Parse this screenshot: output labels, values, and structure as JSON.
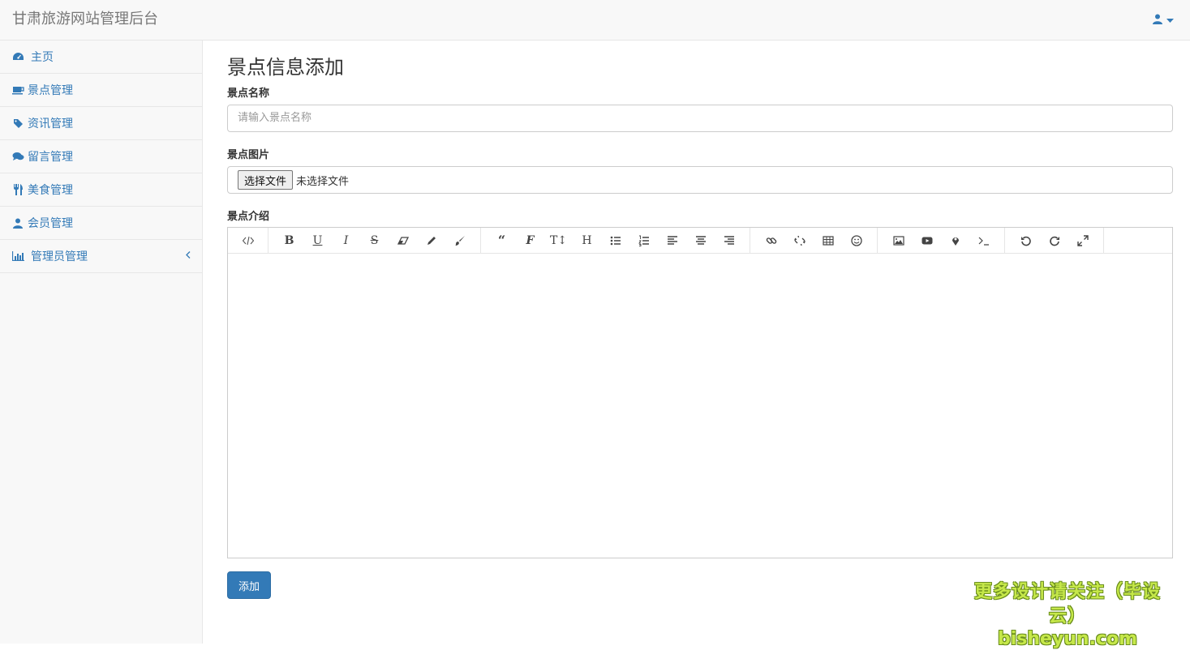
{
  "navbar": {
    "brand": "甘肃旅游网站管理后台",
    "user_icon": "user-icon"
  },
  "sidebar": {
    "items": [
      {
        "label": "主页",
        "icon": "dashboard-icon"
      },
      {
        "label": "景点管理",
        "icon": "coffee-icon"
      },
      {
        "label": "资讯管理",
        "icon": "tag-icon"
      },
      {
        "label": "留言管理",
        "icon": "comments-icon"
      },
      {
        "label": "美食管理",
        "icon": "cutlery-icon"
      },
      {
        "label": "会员管理",
        "icon": "user-icon"
      },
      {
        "label": "管理员管理",
        "icon": "bar-chart-icon"
      }
    ]
  },
  "main": {
    "title": "景点信息添加",
    "name_label": "景点名称",
    "name_placeholder": "请输入景点名称",
    "image_label": "景点图片",
    "file_button": "选择文件",
    "file_status": "未选择文件",
    "intro_label": "景点介绍",
    "submit_label": "添加"
  },
  "editor": {
    "toolbar_groups": [
      [
        "code-view-icon"
      ],
      [
        "bold-icon",
        "underline-icon",
        "italic-icon",
        "strikethrough-icon",
        "eraser-icon",
        "pencil-icon",
        "brush-icon"
      ],
      [
        "quote-icon",
        "font-icon",
        "font-size-icon",
        "heading-icon",
        "bullet-list-icon",
        "ordered-list-icon",
        "align-left-icon",
        "align-center-icon",
        "align-right-icon"
      ],
      [
        "link-icon",
        "unlink-icon",
        "table-icon",
        "emoji-icon"
      ],
      [
        "image-icon",
        "video-icon",
        "map-marker-icon",
        "terminal-icon"
      ],
      [
        "undo-icon",
        "redo-icon",
        "fullscreen-icon"
      ]
    ]
  },
  "watermark": {
    "line1": "更多设计请关注（毕设云）",
    "line2": "bisheyun.com"
  }
}
